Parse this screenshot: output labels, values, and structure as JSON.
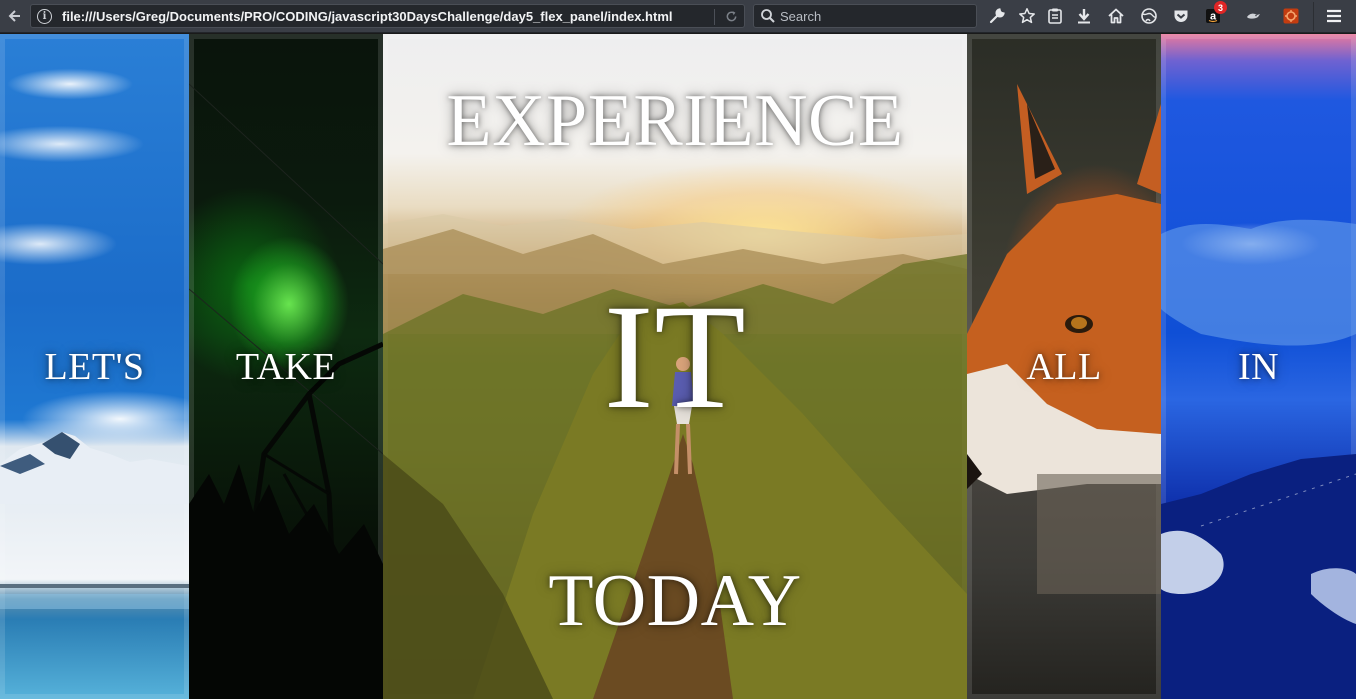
{
  "browser": {
    "url": "file:///Users/Greg/Documents/PRO/CODING/javascript30DaysChallenge/day5_flex_panel/index.html",
    "search_placeholder": "Search",
    "amazon_badge_count": "3",
    "icons": [
      "back-arrow-icon",
      "info-icon",
      "reload-icon",
      "search-icon",
      "wrench-icon",
      "star-icon",
      "clipboard-icon",
      "download-icon",
      "home-icon",
      "globe-icon",
      "pocket-icon",
      "amazon-icon",
      "bird-icon",
      "extension-icon",
      "hamburger-menu-icon"
    ]
  },
  "panels": [
    {
      "id": "p1",
      "words": [
        "LET'S"
      ]
    },
    {
      "id": "p2",
      "words": [
        "TAKE"
      ]
    },
    {
      "id": "p3",
      "words": [
        "EXPERIENCE",
        "IT",
        "TODAY"
      ]
    },
    {
      "id": "p4",
      "words": [
        "ALL"
      ]
    },
    {
      "id": "p5",
      "words": [
        "IN"
      ]
    }
  ]
}
